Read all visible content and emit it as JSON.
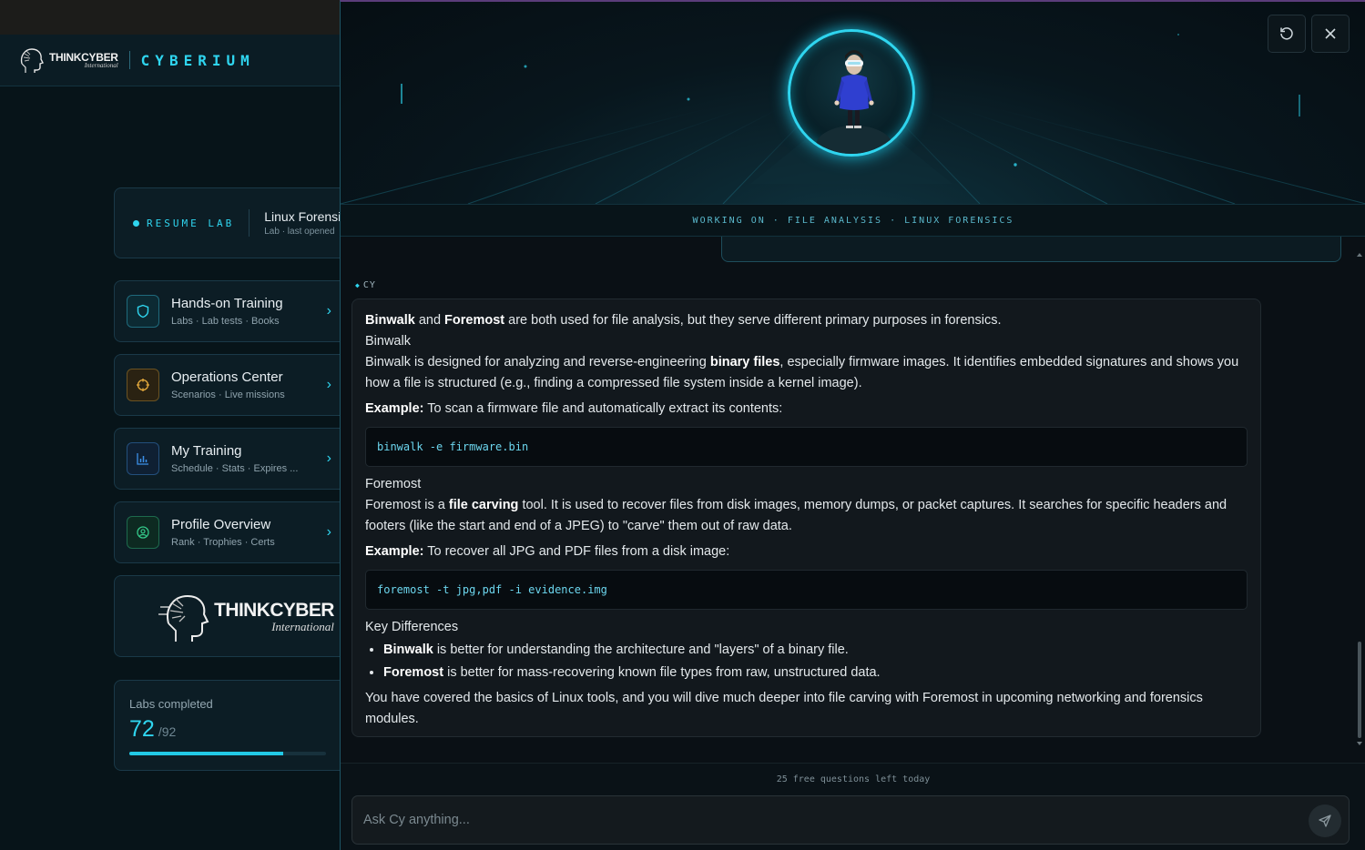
{
  "brand": {
    "small_name": "THINKCYBER",
    "small_sub": "International",
    "product": "CYBERIUM",
    "big_name": "THINKCYBER",
    "big_sub": "International"
  },
  "resume": {
    "label": "RESUME LAB",
    "title": "Linux Forensi",
    "subtitle": "Lab · last opened"
  },
  "menu": [
    {
      "title": "Hands-on Training",
      "subtitle": "Labs · Lab tests · Books",
      "icon": "shield-icon",
      "color": "#2fd5ef"
    },
    {
      "title": "Operations Center",
      "subtitle": "Scenarios · Live missions",
      "icon": "crosshair-icon",
      "color": "#e3a93c"
    },
    {
      "title": "My Training",
      "subtitle": "Schedule · Stats · Expires ...",
      "icon": "bar-chart-icon",
      "color": "#3b8fe8"
    },
    {
      "title": "Profile Overview",
      "subtitle": "Rank · Trophies · Certs",
      "icon": "user-circle-icon",
      "color": "#34c98a"
    }
  ],
  "labs": {
    "label": "Labs completed",
    "completed": "72",
    "total": "/92",
    "progress_fraction": 0.783
  },
  "chat": {
    "working_on": "WORKING ON · FILE ANALYSIS · LINUX FORENSICS",
    "sender": "CY",
    "message": {
      "intro_b1": "Binwalk",
      "intro_and": " and ",
      "intro_b2": "Foremost",
      "intro_rest": " are both used for file analysis, but they serve different primary purposes in forensics.",
      "h_binwalk": "Binwalk",
      "binwalk_p1": "Binwalk is designed for analyzing and reverse-engineering ",
      "binwalk_b": "binary files",
      "binwalk_p2": ", especially firmware images. It identifies embedded signatures and shows you how a file is structured (e.g., finding a compressed file system inside a kernel image).",
      "ex1_label": "Example:",
      "ex1_text": " To scan a firmware file and automatically extract its contents:",
      "code1": "binwalk -e firmware.bin",
      "h_foremost": "Foremost",
      "foremost_p1": "Foremost is a ",
      "foremost_b": "file carving",
      "foremost_p2": " tool. It is used to recover files from disk images, memory dumps, or packet captures. It searches for specific headers and footers (like the start and end of a JPEG) to \"carve\" them out of raw data.",
      "ex2_label": "Example:",
      "ex2_text": " To recover all JPG and PDF files from a disk image:",
      "code2": "foremost -t jpg,pdf -i evidence.img",
      "h_diff": "Key Differences",
      "diff1_b": "Binwalk",
      "diff1_text": " is better for understanding the architecture and \"layers\" of a binary file.",
      "diff2_b": "Foremost",
      "diff2_text": " is better for mass-recovering known file types from raw, unstructured data.",
      "outro": "You have covered the basics of Linux tools, and you will dive much deeper into file carving with Foremost in upcoming networking and forensics modules."
    },
    "free_questions": "25 free questions left today",
    "input_placeholder": "Ask Cy anything..."
  }
}
